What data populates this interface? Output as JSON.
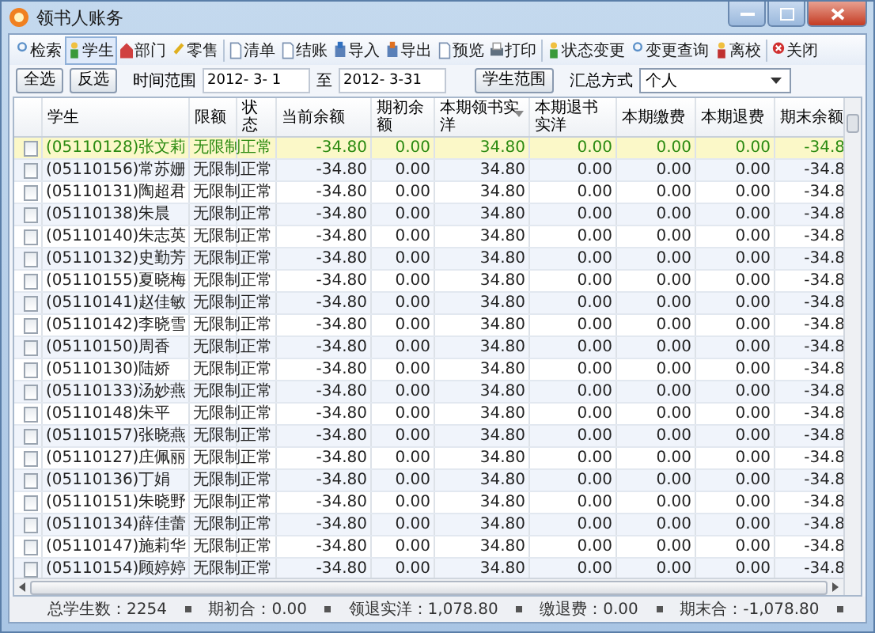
{
  "window": {
    "title": "领书人账务"
  },
  "toolbar": [
    {
      "label": "检索",
      "kind": "search",
      "selected": false
    },
    {
      "label": "学生",
      "kind": "student",
      "selected": true
    },
    {
      "label": "部门",
      "kind": "house",
      "selected": false
    },
    {
      "label": "零售",
      "kind": "tag",
      "selected": false
    },
    {
      "label": "清单",
      "kind": "doc",
      "selected": false,
      "group_start": true
    },
    {
      "label": "结账",
      "kind": "doc",
      "selected": false
    },
    {
      "label": "导入",
      "kind": "import",
      "selected": false
    },
    {
      "label": "导出",
      "kind": "export",
      "selected": false
    },
    {
      "label": "预览",
      "kind": "doc",
      "selected": false
    },
    {
      "label": "打印",
      "kind": "printer",
      "selected": false
    },
    {
      "label": "状态变更",
      "kind": "student",
      "selected": false,
      "group_start": true
    },
    {
      "label": "变更查询",
      "kind": "search",
      "selected": false
    },
    {
      "label": "离校",
      "kind": "leave",
      "selected": false
    },
    {
      "label": "关闭",
      "kind": "close",
      "selected": false,
      "group_start": true
    }
  ],
  "filter": {
    "select_all": "全选",
    "invert": "反选",
    "range_label": "时间范围",
    "date_from": "2012- 3- 1",
    "to_label": "至",
    "date_to": "2012- 3-31",
    "student_range": "学生范围",
    "summary_label": "汇总方式",
    "summary_value": "个人"
  },
  "table": {
    "columns": [
      "学生",
      "限额",
      "状态",
      "当前余额",
      "期初余额",
      "本期领书实洋",
      "本期退书实洋",
      "本期缴费",
      "本期退费",
      "期末余额"
    ],
    "rows": [
      {
        "student": "(05110128)张文莉",
        "limit": "无限制",
        "status": "正常",
        "current": "-34.80",
        "opening": "0.00",
        "issued": "34.80",
        "returned": "0.00",
        "paid": "0.00",
        "refunded": "0.00",
        "closing": "-34.8",
        "checked": false,
        "selected": true
      },
      {
        "student": "(05110156)常苏姗",
        "limit": "无限制",
        "status": "正常",
        "current": "-34.80",
        "opening": "0.00",
        "issued": "34.80",
        "returned": "0.00",
        "paid": "0.00",
        "refunded": "0.00",
        "closing": "-34.8",
        "checked": false,
        "selected": false
      },
      {
        "student": "(05110131)陶超君",
        "limit": "无限制",
        "status": "正常",
        "current": "-34.80",
        "opening": "0.00",
        "issued": "34.80",
        "returned": "0.00",
        "paid": "0.00",
        "refunded": "0.00",
        "closing": "-34.8",
        "checked": false,
        "selected": false
      },
      {
        "student": "(05110138)朱晨",
        "limit": "无限制",
        "status": "正常",
        "current": "-34.80",
        "opening": "0.00",
        "issued": "34.80",
        "returned": "0.00",
        "paid": "0.00",
        "refunded": "0.00",
        "closing": "-34.8",
        "checked": false,
        "selected": false
      },
      {
        "student": "(05110140)朱志英",
        "limit": "无限制",
        "status": "正常",
        "current": "-34.80",
        "opening": "0.00",
        "issued": "34.80",
        "returned": "0.00",
        "paid": "0.00",
        "refunded": "0.00",
        "closing": "-34.8",
        "checked": false,
        "selected": false
      },
      {
        "student": "(05110132)史勤芳",
        "limit": "无限制",
        "status": "正常",
        "current": "-34.80",
        "opening": "0.00",
        "issued": "34.80",
        "returned": "0.00",
        "paid": "0.00",
        "refunded": "0.00",
        "closing": "-34.8",
        "checked": false,
        "selected": false
      },
      {
        "student": "(05110155)夏晓梅",
        "limit": "无限制",
        "status": "正常",
        "current": "-34.80",
        "opening": "0.00",
        "issued": "34.80",
        "returned": "0.00",
        "paid": "0.00",
        "refunded": "0.00",
        "closing": "-34.8",
        "checked": false,
        "selected": false
      },
      {
        "student": "(05110141)赵佳敏",
        "limit": "无限制",
        "status": "正常",
        "current": "-34.80",
        "opening": "0.00",
        "issued": "34.80",
        "returned": "0.00",
        "paid": "0.00",
        "refunded": "0.00",
        "closing": "-34.8",
        "checked": false,
        "selected": false
      },
      {
        "student": "(05110142)李晓雪",
        "limit": "无限制",
        "status": "正常",
        "current": "-34.80",
        "opening": "0.00",
        "issued": "34.80",
        "returned": "0.00",
        "paid": "0.00",
        "refunded": "0.00",
        "closing": "-34.8",
        "checked": false,
        "selected": false
      },
      {
        "student": "(05110150)周香",
        "limit": "无限制",
        "status": "正常",
        "current": "-34.80",
        "opening": "0.00",
        "issued": "34.80",
        "returned": "0.00",
        "paid": "0.00",
        "refunded": "0.00",
        "closing": "-34.8",
        "checked": false,
        "selected": false
      },
      {
        "student": "(05110130)陆娇",
        "limit": "无限制",
        "status": "正常",
        "current": "-34.80",
        "opening": "0.00",
        "issued": "34.80",
        "returned": "0.00",
        "paid": "0.00",
        "refunded": "0.00",
        "closing": "-34.8",
        "checked": false,
        "selected": false
      },
      {
        "student": "(05110133)汤妙燕",
        "limit": "无限制",
        "status": "正常",
        "current": "-34.80",
        "opening": "0.00",
        "issued": "34.80",
        "returned": "0.00",
        "paid": "0.00",
        "refunded": "0.00",
        "closing": "-34.8",
        "checked": false,
        "selected": false
      },
      {
        "student": "(05110148)朱平",
        "limit": "无限制",
        "status": "正常",
        "current": "-34.80",
        "opening": "0.00",
        "issued": "34.80",
        "returned": "0.00",
        "paid": "0.00",
        "refunded": "0.00",
        "closing": "-34.8",
        "checked": false,
        "selected": false
      },
      {
        "student": "(05110157)张晓燕",
        "limit": "无限制",
        "status": "正常",
        "current": "-34.80",
        "opening": "0.00",
        "issued": "34.80",
        "returned": "0.00",
        "paid": "0.00",
        "refunded": "0.00",
        "closing": "-34.8",
        "checked": false,
        "selected": false
      },
      {
        "student": "(05110127)庄佩丽",
        "limit": "无限制",
        "status": "正常",
        "current": "-34.80",
        "opening": "0.00",
        "issued": "34.80",
        "returned": "0.00",
        "paid": "0.00",
        "refunded": "0.00",
        "closing": "-34.8",
        "checked": false,
        "selected": false
      },
      {
        "student": "(05110136)丁娟",
        "limit": "无限制",
        "status": "正常",
        "current": "-34.80",
        "opening": "0.00",
        "issued": "34.80",
        "returned": "0.00",
        "paid": "0.00",
        "refunded": "0.00",
        "closing": "-34.8",
        "checked": false,
        "selected": false
      },
      {
        "student": "(05110151)朱晓野",
        "limit": "无限制",
        "status": "正常",
        "current": "-34.80",
        "opening": "0.00",
        "issued": "34.80",
        "returned": "0.00",
        "paid": "0.00",
        "refunded": "0.00",
        "closing": "-34.8",
        "checked": false,
        "selected": false
      },
      {
        "student": "(05110134)薛佳蕾",
        "limit": "无限制",
        "status": "正常",
        "current": "-34.80",
        "opening": "0.00",
        "issued": "34.80",
        "returned": "0.00",
        "paid": "0.00",
        "refunded": "0.00",
        "closing": "-34.8",
        "checked": false,
        "selected": false
      },
      {
        "student": "(05110147)施莉华",
        "limit": "无限制",
        "status": "正常",
        "current": "-34.80",
        "opening": "0.00",
        "issued": "34.80",
        "returned": "0.00",
        "paid": "0.00",
        "refunded": "0.00",
        "closing": "-34.8",
        "checked": false,
        "selected": false
      },
      {
        "student": "(05110154)顾婷婷",
        "limit": "无限制",
        "status": "正常",
        "current": "-34.80",
        "opening": "0.00",
        "issued": "34.80",
        "returned": "0.00",
        "paid": "0.00",
        "refunded": "0.00",
        "closing": "-34.8",
        "checked": false,
        "selected": false
      }
    ]
  },
  "status_bar": [
    "总学生数：2254",
    "期初合：0.00",
    "领退实洋：1,078.80",
    "缴退费：0.00",
    "期末合：-1,078.80"
  ]
}
